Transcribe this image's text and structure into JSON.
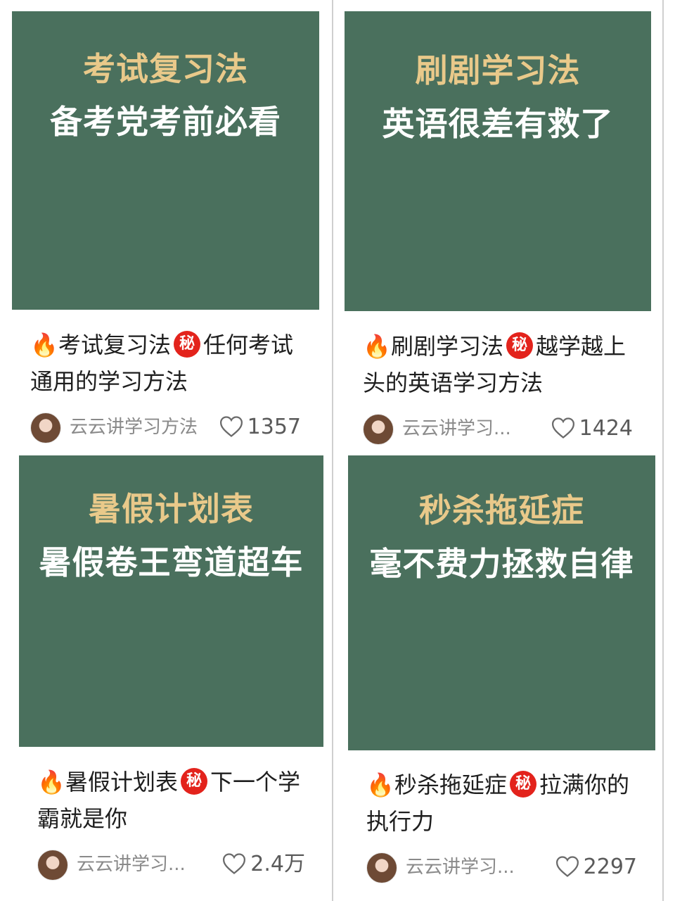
{
  "colors": {
    "cover_bg": "#4a705d",
    "title_gold": "#e9c98a",
    "subtitle_white": "#ffffff",
    "secret_badge_red": "#e3231c",
    "meta_gray": "#8a8a8a"
  },
  "badge_text": "秘",
  "cards": [
    {
      "cover_title": "考试复习法",
      "cover_subtitle": "备考党考前必看",
      "caption_prefix": "考试复习法",
      "caption_suffix": "任何考试通用的学习方法",
      "author": "云云讲学习方法",
      "likes": "1357"
    },
    {
      "cover_title": "刷剧学习法",
      "cover_subtitle": "英语很差有救了",
      "caption_prefix": "刷剧学习法",
      "caption_suffix": "越学越上头的英语学习方法",
      "author": "云云讲学习...",
      "likes": "1424"
    },
    {
      "cover_title": "暑假计划表",
      "cover_subtitle": "暑假卷王弯道超车",
      "caption_prefix": "暑假计划表",
      "caption_suffix": "下一个学霸就是你",
      "author": "云云讲学习...",
      "likes": "2.4万"
    },
    {
      "cover_title": "秒杀拖延症",
      "cover_subtitle": "毫不费力拯救自律",
      "caption_prefix": "秒杀拖延症",
      "caption_suffix": "拉满你的执行力",
      "author": "云云讲学习...",
      "likes": "2297"
    }
  ]
}
